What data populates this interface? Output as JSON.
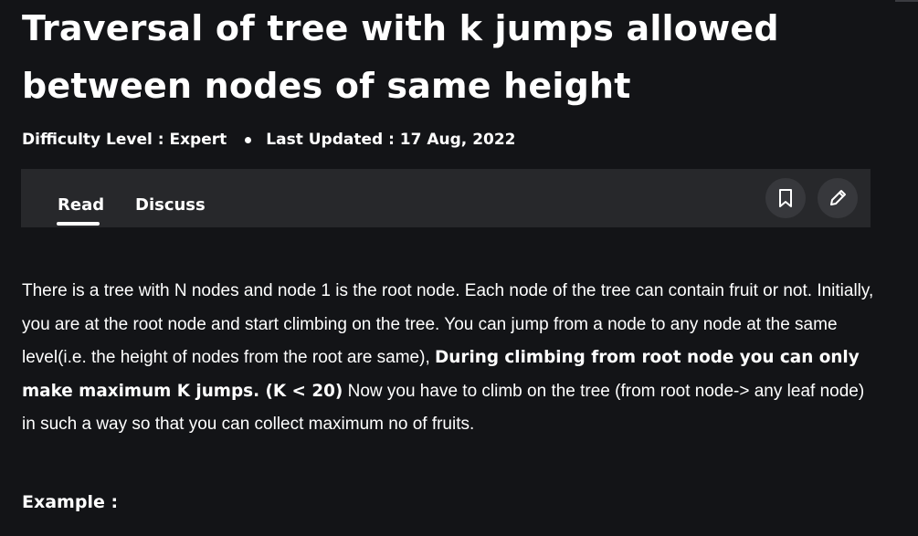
{
  "article": {
    "title": "Traversal of tree with k jumps allowed between nodes of same height",
    "difficulty": "Difficulty Level : Expert",
    "last_updated": "Last Updated : 17 Aug, 2022"
  },
  "tabs": {
    "read": "Read",
    "discuss": "Discuss"
  },
  "icons": {
    "bookmark": "bookmark-icon",
    "edit": "pencil-icon"
  },
  "content": {
    "p1_text_1": "There is a tree with N nodes and node 1 is the root node. Each node of the tree can contain fruit or not. Initially, you are at the root node and start climbing on the tree. You can jump from a node to any node at the same level(i.e. the height of nodes from the root are same), ",
    "p1_bold": "During climbing from root node you can only make maximum K jumps. (K < 20)",
    "p1_text_2": " Now you have to climb on the tree (from root node-> any leaf node) in such a way so that you can collect maximum no of fruits.",
    "example_heading": "Example :"
  },
  "colors": {
    "background": "#131417",
    "tabbar": "#27282b",
    "icon_button": "#37383c",
    "text": "#ffffff"
  }
}
